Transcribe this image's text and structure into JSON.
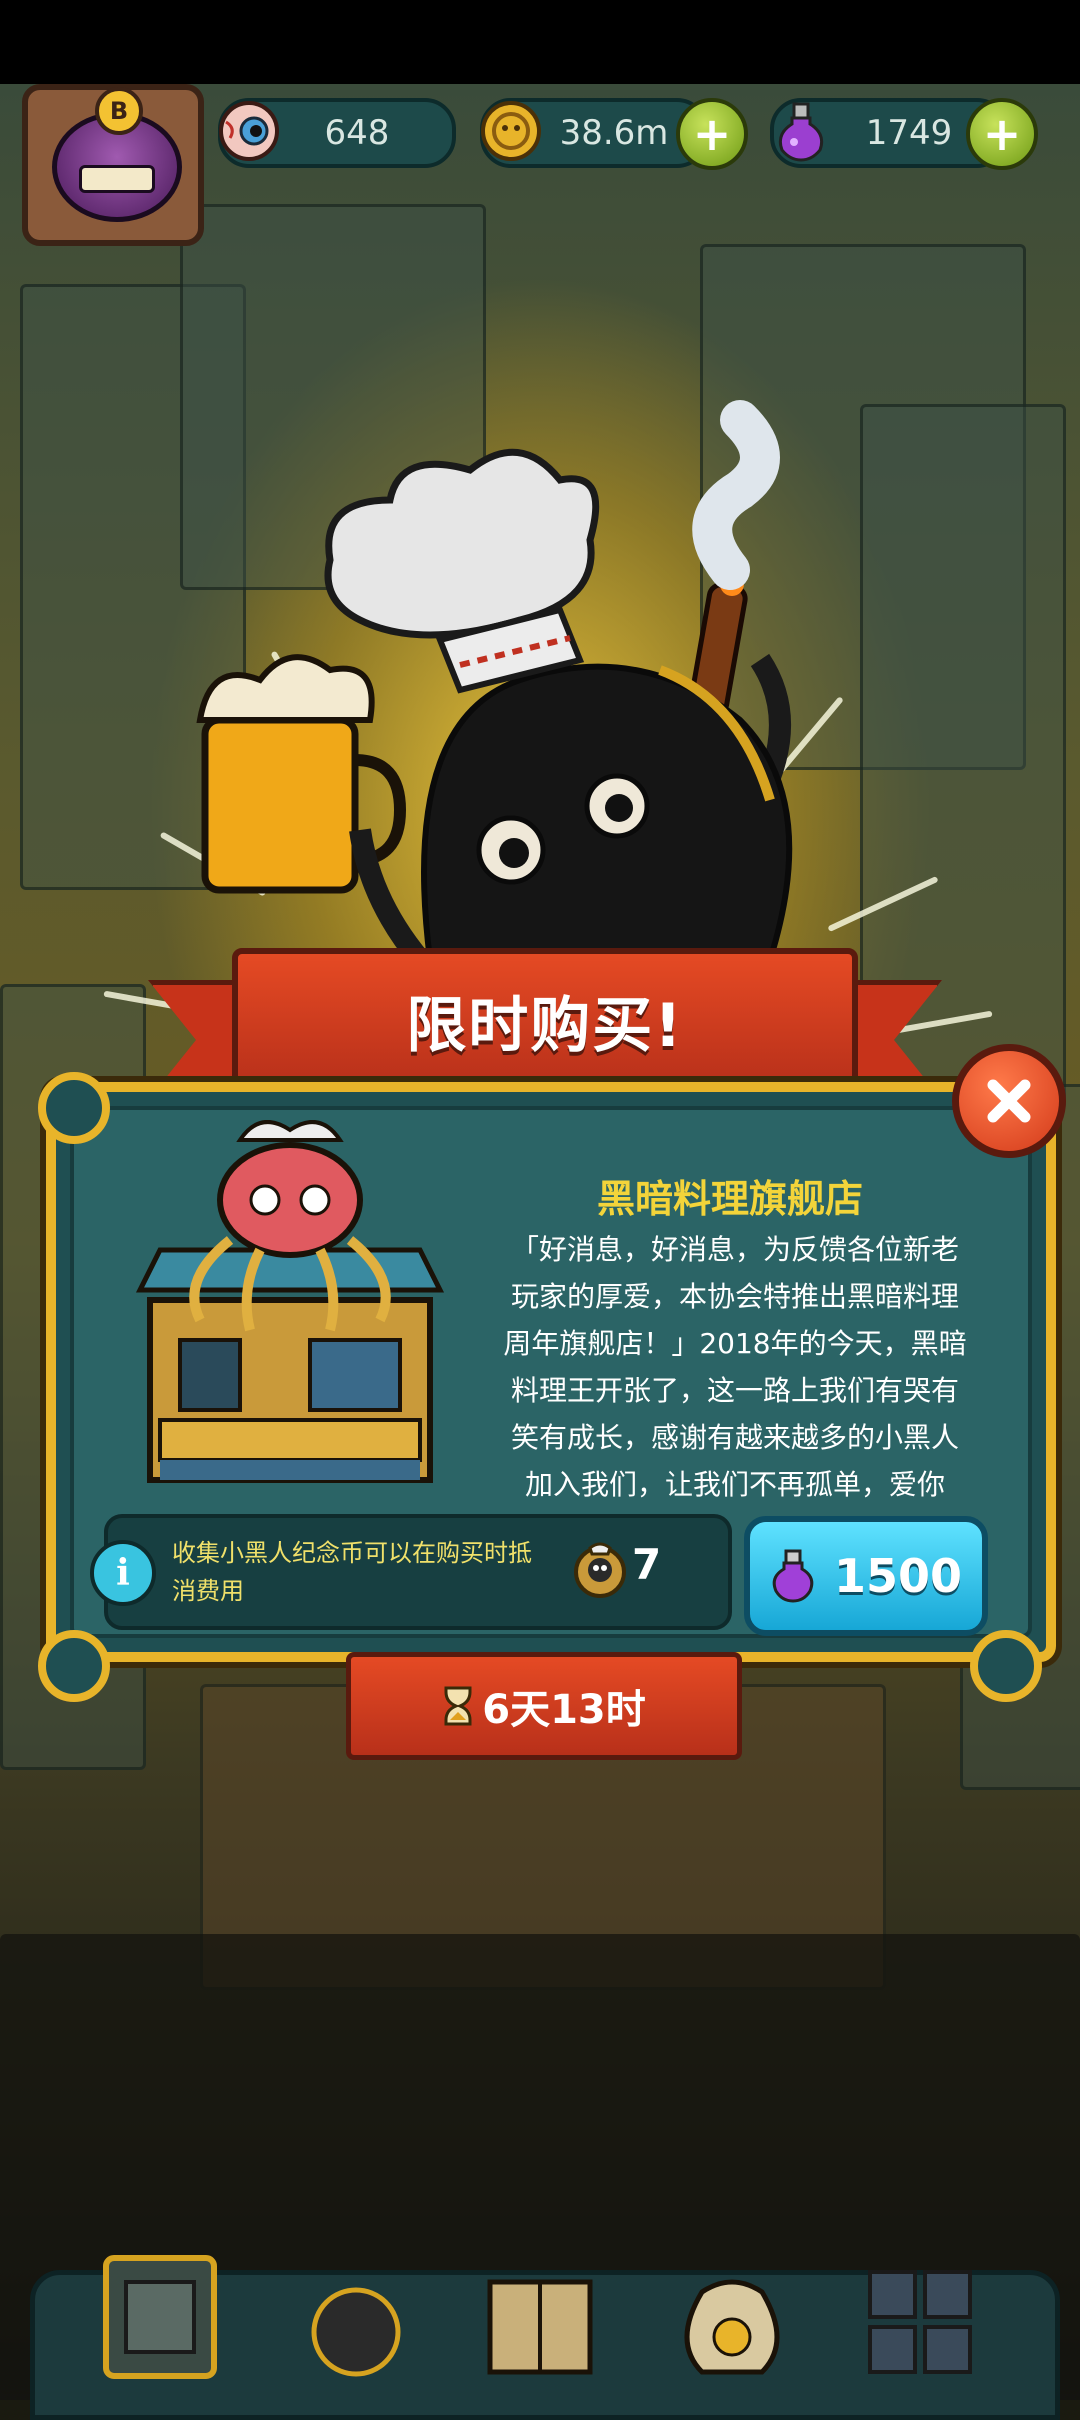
{
  "resources": {
    "eyes": "648",
    "coins": "38.6m",
    "potions": "1749"
  },
  "avatar": {
    "badge_letter": "B"
  },
  "popup": {
    "ribbon_title": "限时购买!",
    "shop_title": "黑暗料理旗舰店",
    "description_lines": [
      "「好消息，好消息，为反馈各位新老",
      "玩家的厚爱，本协会特推出黑暗料理",
      "周年旗舰店！」2018年的今天，黑暗",
      "料理王开张了，这一路上我们有哭有",
      "笑有成长，感谢有越来越多的小黑人",
      "加入我们，让我们不再孤单，爱你"
    ],
    "info_text": "收集小黑人纪念币可以在购买时抵消费用",
    "info_icon_letter": "i",
    "commemorative_coins": "7",
    "price": "1500",
    "timer": "6天13时"
  },
  "colors": {
    "ribbon": "#d83d1f",
    "panel": "#1f4f52",
    "gold_frame": "#e8b42a",
    "buy_button": "#29b9e6",
    "title_yellow": "#f3d43a"
  },
  "icons": {
    "eye": "eyeball-icon",
    "coin": "coin-icon",
    "potion": "potion-icon",
    "close": "close-icon",
    "hourglass": "hourglass-icon",
    "info": "info-icon"
  }
}
